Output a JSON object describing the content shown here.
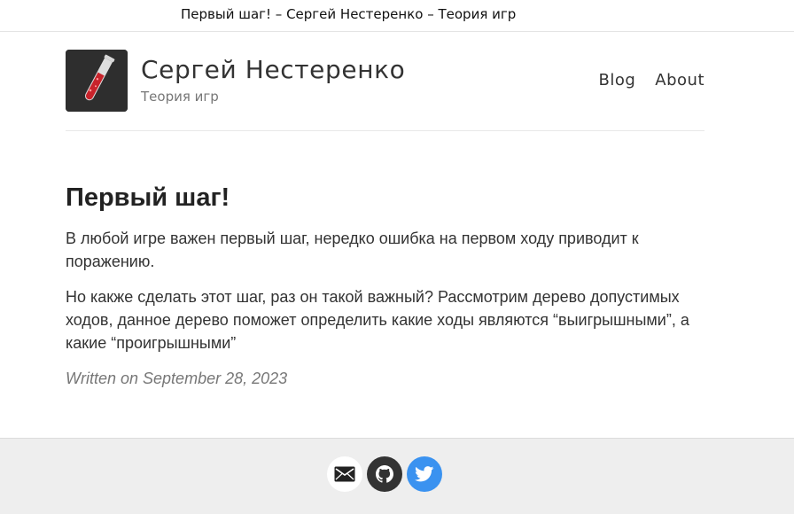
{
  "window": {
    "title": "Первый шаг! – Сергей Нестеренко – Теория игр"
  },
  "header": {
    "site_name": "Сергей Нестеренко",
    "tagline": "Теория игр",
    "logo_icon": "test-tube-icon",
    "nav": [
      {
        "label": "Blog"
      },
      {
        "label": "About"
      }
    ]
  },
  "post": {
    "title": "Первый шаг!",
    "paragraphs": [
      "В любой игре важен первый шаг, нередко ошибка на первом ходу приводит к поражению.",
      "Но какже сделать этот шаг, раз он такой важный? Рассмотрим дерево допустимых ходов, данное дерево поможет определить какие ходы являются “выигрышными”, а какие “проигрышными”"
    ],
    "date": "Written on September 28, 2023"
  },
  "footer": {
    "social": [
      {
        "icon": "email-icon",
        "color": "#ffffff"
      },
      {
        "icon": "github-icon",
        "color": "#333333"
      },
      {
        "icon": "twitter-icon",
        "color": "#3a92f0"
      }
    ]
  }
}
